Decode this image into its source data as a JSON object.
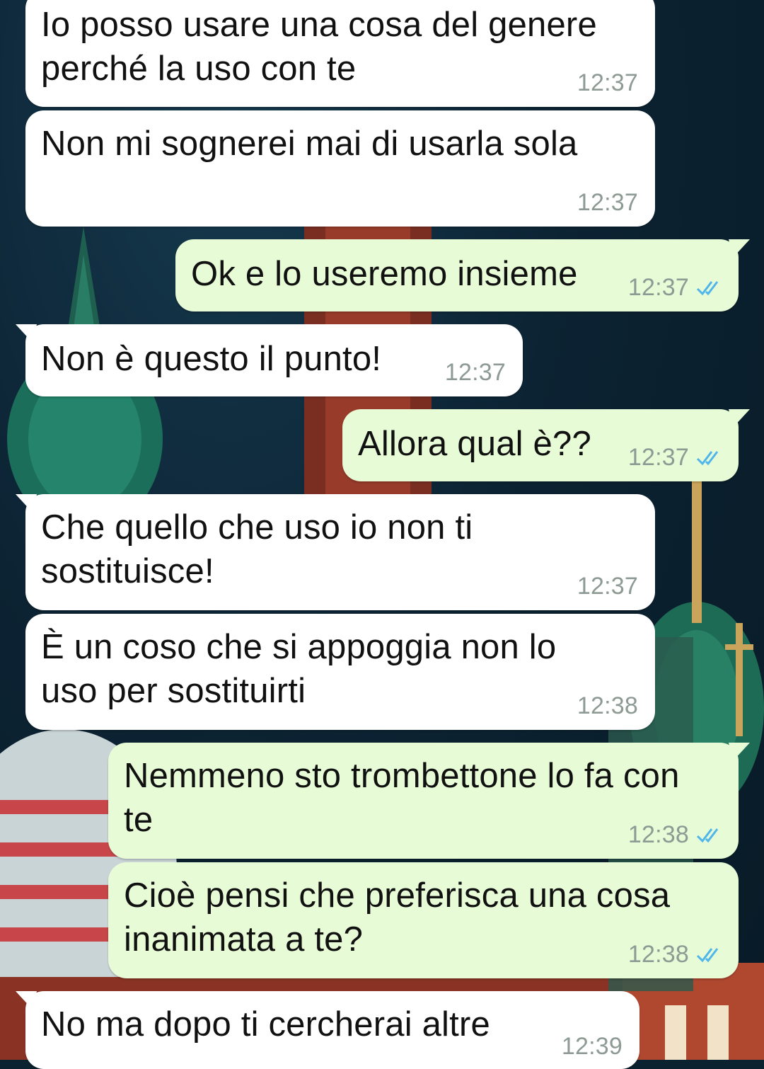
{
  "messages": [
    {
      "direction": "incoming",
      "text": "Io posso usare una cosa del genere\nperché la uso con te",
      "time": "12:37"
    },
    {
      "direction": "incoming",
      "text": "Non mi sognerei mai di usarla sola",
      "time": "12:37"
    },
    {
      "direction": "outgoing",
      "text": "Ok e lo useremo insieme",
      "time": "12:37",
      "status": "read"
    },
    {
      "direction": "incoming",
      "text": "Non è questo il punto!",
      "time": "12:37"
    },
    {
      "direction": "outgoing",
      "text": "Allora qual è??",
      "time": "12:37",
      "status": "read"
    },
    {
      "direction": "incoming",
      "text": "Che quello che uso io non ti\nsostituisce!",
      "time": "12:37"
    },
    {
      "direction": "incoming",
      "text": "È un coso che si appoggia non lo\nuso per sostituirti",
      "time": "12:38"
    },
    {
      "direction": "outgoing",
      "text": "Nemmeno sto trombettone lo fa con\nte",
      "time": "12:38",
      "status": "read"
    },
    {
      "direction": "outgoing",
      "text": "Cioè pensi che preferisca una cosa\ninanimata a te?",
      "time": "12:38",
      "status": "read"
    },
    {
      "direction": "incoming",
      "text": "No ma dopo ti cercherai altre",
      "time": "12:39"
    }
  ],
  "colors": {
    "incoming_bubble": "#ffffff",
    "outgoing_bubble": "#e7fbd6",
    "timestamp": "#8e9a94",
    "read_tick": "#4fb6ec"
  },
  "icons": {
    "read_receipt": "double-check-icon"
  }
}
